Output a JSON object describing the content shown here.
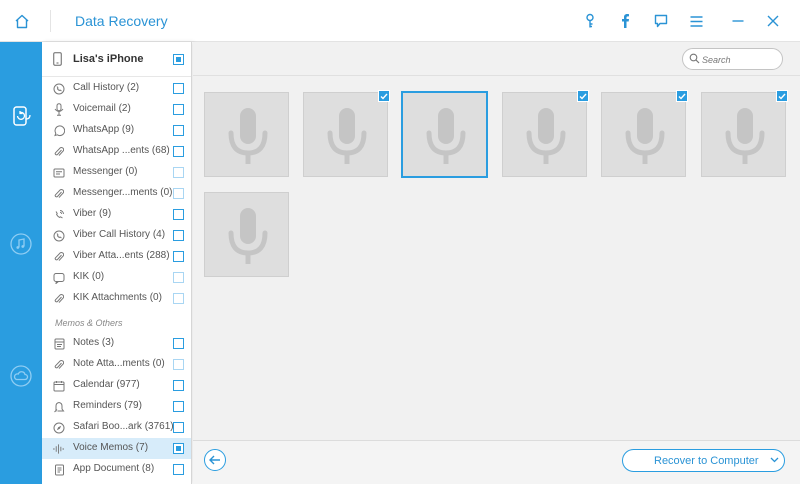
{
  "app": {
    "title": "Data Recovery"
  },
  "device": {
    "name": "Lisa's iPhone"
  },
  "categories": [
    {
      "label": "Call History (2)",
      "icon": "phone-icon"
    },
    {
      "label": "Voicemail (2)",
      "icon": "voicemail-mic-icon"
    },
    {
      "label": "WhatsApp (9)",
      "icon": "whatsapp-icon"
    },
    {
      "label": "WhatsApp ...ents (68)",
      "icon": "attachment-icon"
    },
    {
      "label": "Messenger (0)",
      "icon": "messenger-icon"
    },
    {
      "label": "Messenger...ments (0)",
      "icon": "attachment-icon"
    },
    {
      "label": "Viber (9)",
      "icon": "viber-icon"
    },
    {
      "label": "Viber Call History (4)",
      "icon": "viber-call-icon"
    },
    {
      "label": "Viber Atta...ents (288)",
      "icon": "attachment-icon"
    },
    {
      "label": "KIK (0)",
      "icon": "kik-icon"
    },
    {
      "label": "KIK Attachments (0)",
      "icon": "attachment-icon"
    }
  ],
  "section_memos": "Memos & Others",
  "memo_items": [
    {
      "label": "Notes (3)",
      "icon": "notes-icon"
    },
    {
      "label": "Note Atta...ments (0)",
      "icon": "attachment-icon"
    },
    {
      "label": "Calendar (977)",
      "icon": "calendar-icon"
    },
    {
      "label": "Reminders (79)",
      "icon": "reminders-icon"
    },
    {
      "label": "Safari Boo...ark (3761)",
      "icon": "safari-icon"
    },
    {
      "label": "Voice Memos (7)",
      "icon": "waveform-icon"
    },
    {
      "label": "App Document (8)",
      "icon": "document-icon"
    }
  ],
  "search": {
    "placeholder": "Search"
  },
  "actions": {
    "recover_label": "Recover to Computer"
  },
  "tiles": [
    {
      "checked": false,
      "selected": false
    },
    {
      "checked": true,
      "selected": false
    },
    {
      "checked": false,
      "selected": true
    },
    {
      "checked": true,
      "selected": false
    },
    {
      "checked": true,
      "selected": false
    },
    {
      "checked": true,
      "selected": false
    },
    {
      "checked": false,
      "selected": false
    }
  ],
  "colors": {
    "accent": "#2a9de0",
    "rail": "#2a9de0",
    "tile": "#dedede"
  }
}
